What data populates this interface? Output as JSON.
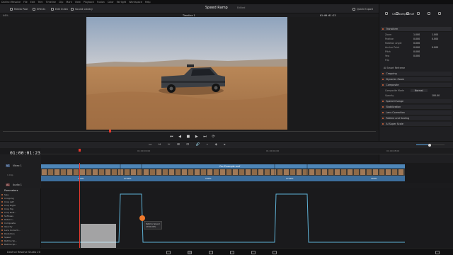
{
  "menubar": {
    "app": "DaVinci Resolve",
    "items": [
      "File",
      "Edit",
      "Trim",
      "Timeline",
      "Clip",
      "Mark",
      "View",
      "Playback",
      "Fusion",
      "Color",
      "Fairlight",
      "Workspace",
      "Help"
    ]
  },
  "toolbar": {
    "media_pool": "Media Pool",
    "effects": "Effects",
    "edit_index": "Edit Index",
    "sound_library": "Sound Library",
    "quick_export": "Quick Export",
    "mixer": "Mixer",
    "metadata": "Metadata",
    "inspector": "Inspector",
    "project_title": "Speed Ramp",
    "project_status": "Edited"
  },
  "viewer": {
    "zoom": "44%",
    "timeline_name": "Timeline 1",
    "timecode": "01:00:01:23"
  },
  "inspector": {
    "clip_name": "Car Example.mxf",
    "section_transform": "Transform",
    "props": [
      {
        "label": "Zoom",
        "x_name": "X",
        "x": "1.000",
        "y_name": "Y",
        "y": "1.000"
      },
      {
        "label": "Position",
        "x_name": "X",
        "x": "0.000",
        "y_name": "Y",
        "y": "0.000"
      },
      {
        "label": "Rotation Angle",
        "x_name": "",
        "x": "0.000",
        "y_name": "",
        "y": ""
      },
      {
        "label": "Anchor Point",
        "x_name": "X",
        "x": "0.000",
        "y_name": "Y",
        "y": "0.000"
      },
      {
        "label": "Pitch",
        "x_name": "",
        "x": "0.000",
        "y_name": "",
        "y": ""
      },
      {
        "label": "Yaw",
        "x_name": "",
        "x": "0.000",
        "y_name": "",
        "y": ""
      },
      {
        "label": "Flip",
        "x_name": "",
        "x": "",
        "y_name": "",
        "y": ""
      }
    ],
    "smart_reframe": "AI Smart Reframe",
    "sections": [
      "Cropping",
      "Dynamic Zoom",
      "Composite"
    ],
    "composite_mode_label": "Composite Mode",
    "composite_mode": "Normal",
    "opacity_label": "Opacity",
    "opacity": "100.00",
    "sections2": [
      "Speed Change",
      "Stabilization",
      "Lens Correction",
      "Retime and Scaling",
      "AI Super Scale"
    ]
  },
  "timeline": {
    "timecode": "01:00:01:23",
    "ruler_marks": [
      "01:00:00:00",
      "01:00:04:00",
      "01:00:08:00"
    ],
    "video_track_label": "Video 1",
    "video_track_id": "V1",
    "clip_count": "1 Clip",
    "clip_name": "Car Example.mxf",
    "audio_track_id": "A1",
    "audio_track_label": "Audio 1",
    "speed_labels": [
      "100%",
      "2740%",
      "100%",
      "2740%",
      "100%"
    ]
  },
  "parameters": {
    "header": "Parameters",
    "items": [
      "Size",
      "Cropping",
      "Crop Left",
      "Crop Right",
      "Crop Top",
      "Crop Bott...",
      "Softness",
      "Retain I...",
      "Composite",
      "Opacity",
      "Lens Correcti...",
      "Distortion",
      "Speed",
      "Retime Sp...",
      "Retime Sp..."
    ]
  },
  "tooltip": {
    "title": "Retime Speed",
    "value": "2740.00%"
  },
  "app_footer": "DaVinci Resolve Studio 20"
}
